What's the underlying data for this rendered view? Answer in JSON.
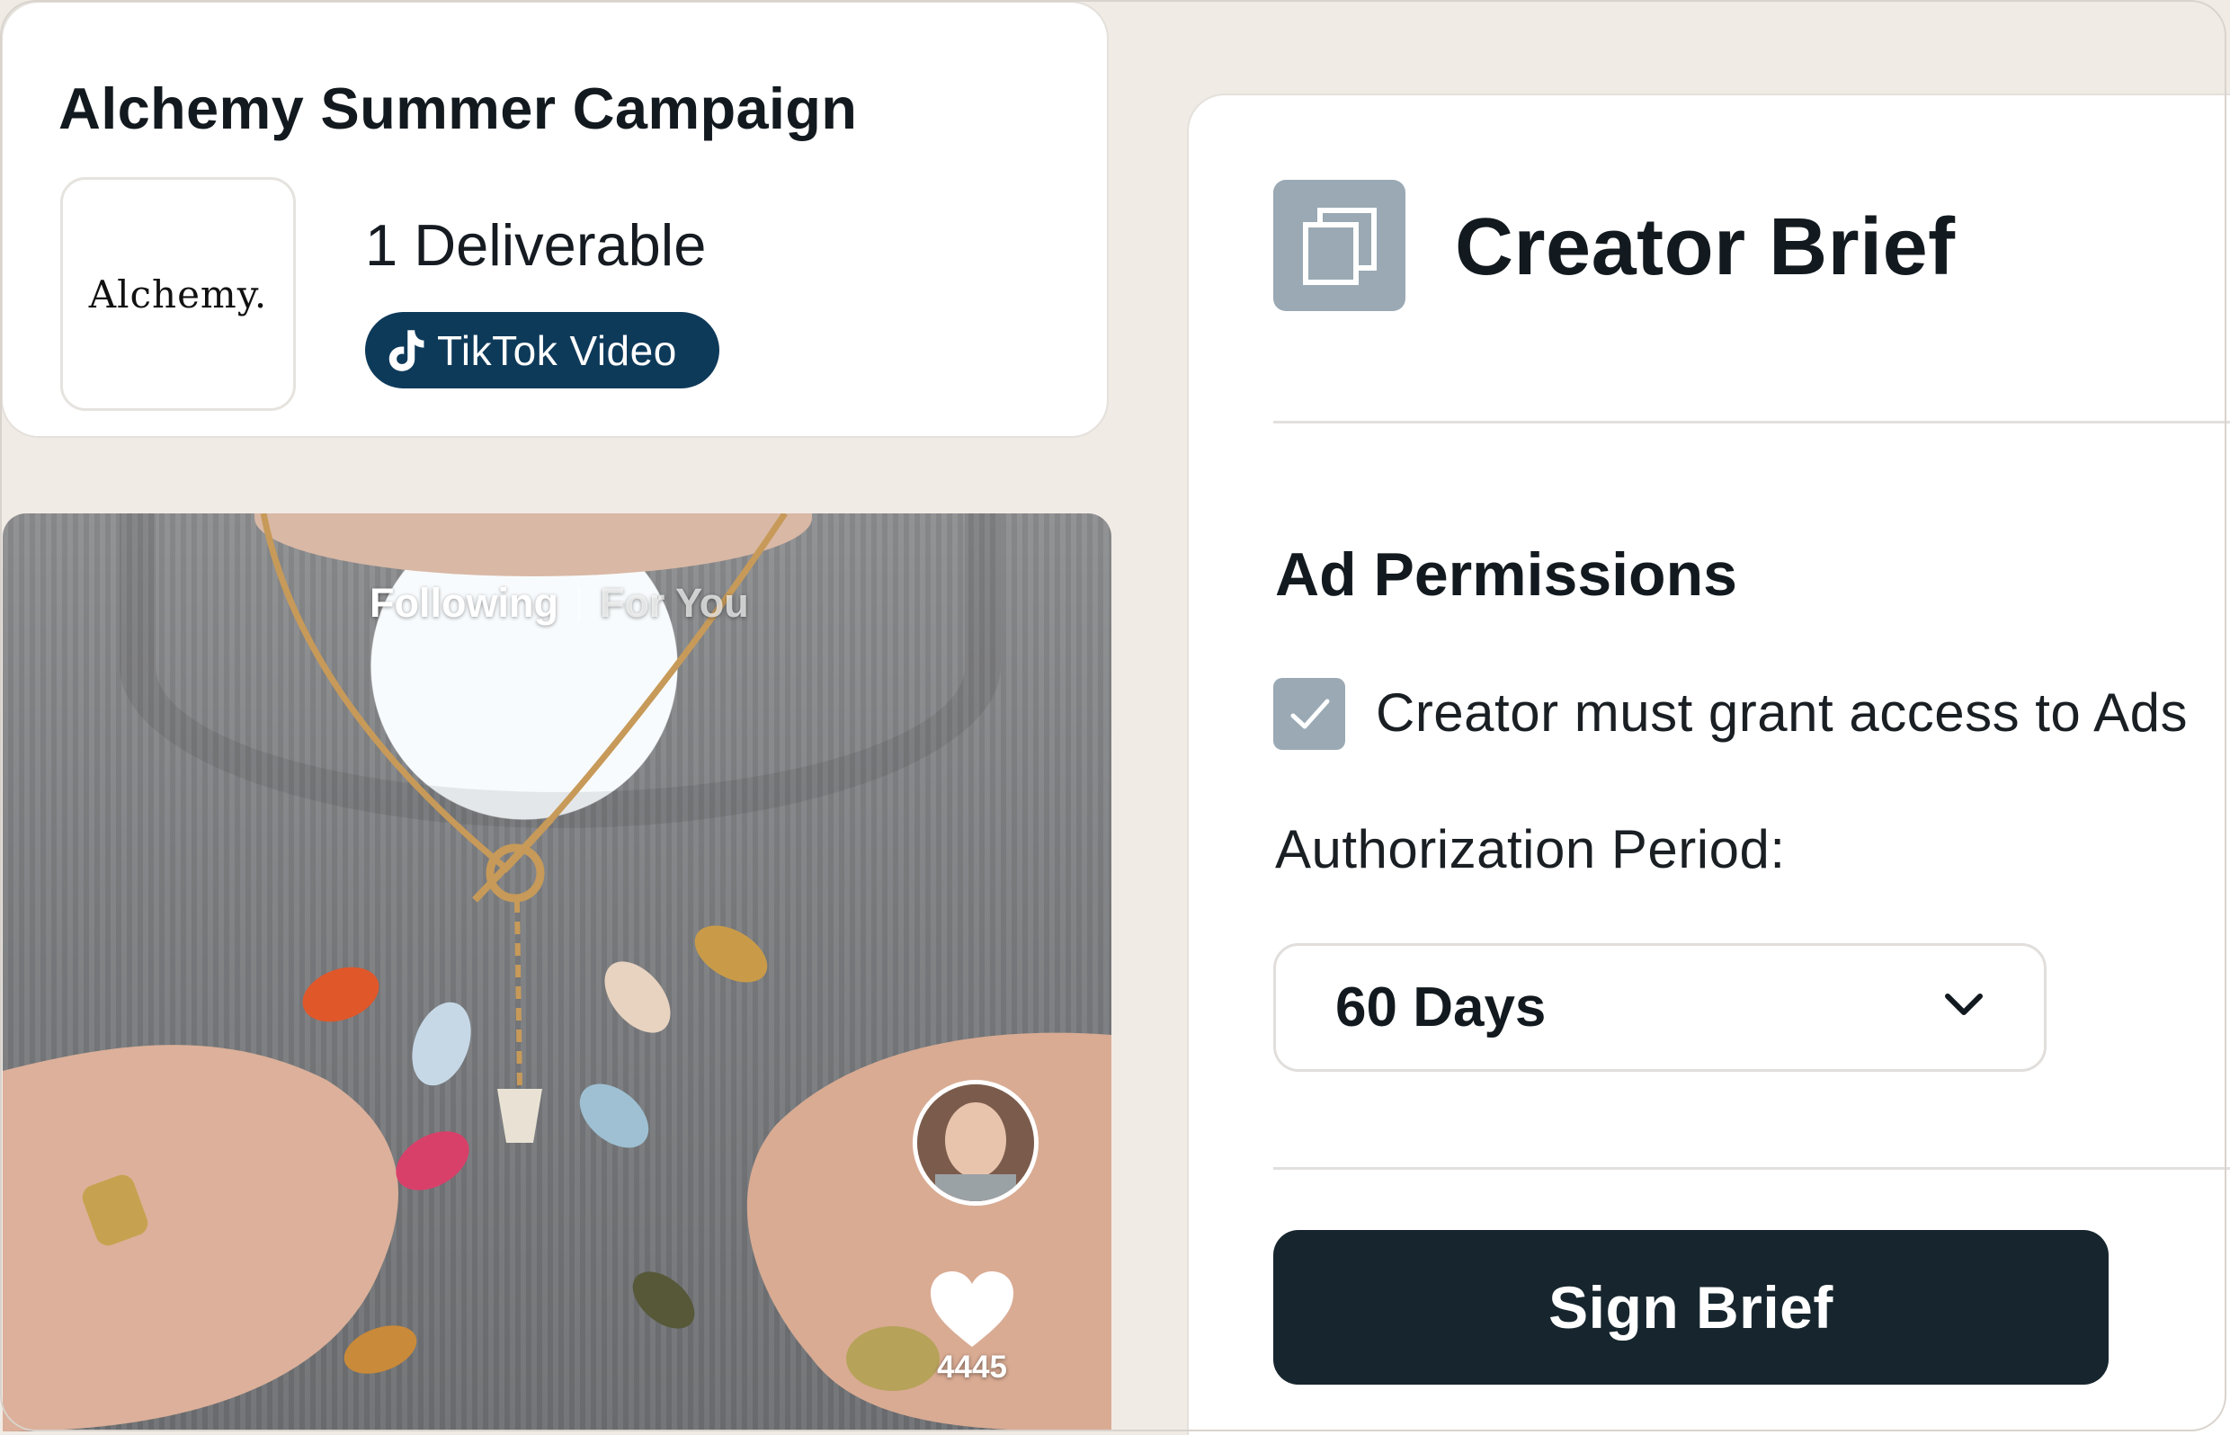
{
  "campaign": {
    "title": "Alchemy Summer Campaign",
    "logo_text": "Alchemy.",
    "deliverables": "1 Deliverable",
    "deliverable_type": "TikTok Video",
    "deliverable_icon": "tiktok-icon",
    "pill_color": "#0e3a5a"
  },
  "video": {
    "tabs": [
      "Following",
      "For You"
    ],
    "like_count": "4445",
    "like_icon": "heart-icon"
  },
  "brief": {
    "icon": "copy-icon",
    "title": "Creator Brief",
    "section_title": "Ad Permissions",
    "checkbox_checked": true,
    "checkbox_label": "Creator must grant access to Ads",
    "auth_label": "Authorization Period:",
    "auth_value": "60 Days",
    "select_icon": "chevron-down-icon",
    "sign_label": "Sign Brief",
    "button_color": "#17262e"
  }
}
